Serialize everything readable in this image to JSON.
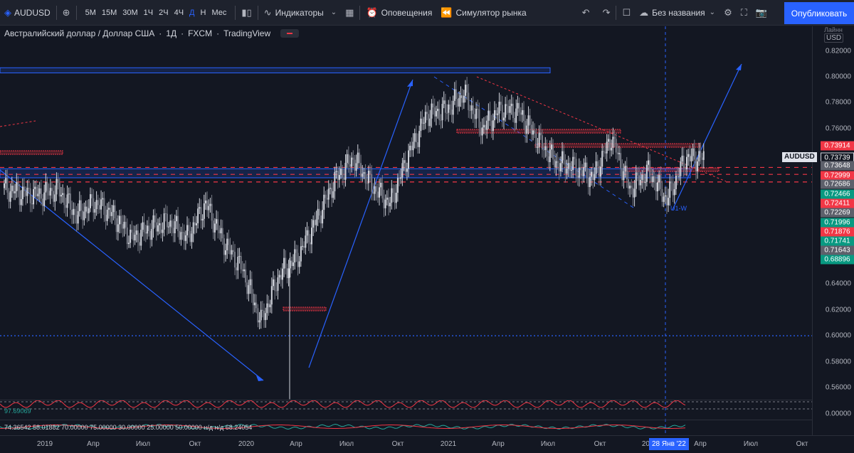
{
  "toolbar": {
    "symbol": "AUDUSD",
    "intervals": [
      "5М",
      "15М",
      "30М",
      "1Ч",
      "2Ч",
      "4Ч",
      "Д",
      "Н",
      "Мес"
    ],
    "active_interval": "Д",
    "indicators_label": "Индикаторы",
    "alerts_label": "Оповещения",
    "replay_label": "Симулятор рынка",
    "layout_name": "Без названия",
    "publish_label": "Опубликовать"
  },
  "legend": {
    "title": "Австралийский доллар / Доллар США",
    "interval": "1Д",
    "exchange": "FXCM",
    "source": "TradingView"
  },
  "price_axis": {
    "unit_label": "Лайнн",
    "currency": "USD",
    "ticks": [
      "0.82000",
      "0.80000",
      "0.78000",
      "0.76000",
      "0.64000",
      "0.62000",
      "0.60000",
      "0.58000",
      "0.56000",
      "0.00000"
    ],
    "tags": [
      {
        "value": "0.73914",
        "color": "#f23645"
      },
      {
        "value": "0.73739",
        "color": "#131722"
      },
      {
        "value": "0.73648",
        "color": "#5d606b"
      },
      {
        "value": "0.72999",
        "color": "#f23645"
      },
      {
        "value": "0.72686",
        "color": "#5d606b"
      },
      {
        "value": "0.72466",
        "color": "#089981"
      },
      {
        "value": "0.72411",
        "color": "#f23645"
      },
      {
        "value": "0.72269",
        "color": "#5d606b"
      },
      {
        "value": "0.71996",
        "color": "#089981"
      },
      {
        "value": "0.71876",
        "color": "#f23645"
      },
      {
        "value": "0.71741",
        "color": "#089981"
      },
      {
        "value": "0.71643",
        "color": "#5d606b"
      },
      {
        "value": "0.68896",
        "color": "#089981"
      }
    ],
    "symbol_label": "AUDUSD"
  },
  "time_axis": {
    "labels": [
      "2019",
      "Апр",
      "Июл",
      "Окт",
      "2020",
      "Апр",
      "Июл",
      "Окт",
      "2021",
      "Апр",
      "Июл",
      "Окт",
      "2022",
      "Апр",
      "Июл",
      "Окт"
    ],
    "cursor_date": "28 Янв '22"
  },
  "oscillators": {
    "osc1_value": "97.69069",
    "osc2_values": "74.36542 58.01882 70.00000 75.00000 30.00000 25.00000 50.00000 н/д н/д 68.24054"
  },
  "annotations": {
    "pattern_label": "U1-W"
  },
  "colors": {
    "up": "#089981",
    "down": "#f23645",
    "accent": "#2962ff",
    "zone": "#2962ff"
  },
  "chart_data": {
    "type": "candlestick",
    "title": "Австралийский доллар / Доллар США",
    "xlabel": "",
    "ylabel": "",
    "ylim": [
      0.55,
      0.83
    ],
    "x": [
      "2019-01",
      "2019-02",
      "2019-03",
      "2019-04",
      "2019-05",
      "2019-06",
      "2019-07",
      "2019-08",
      "2019-09",
      "2019-10",
      "2019-11",
      "2019-12",
      "2020-01",
      "2020-02",
      "2020-03",
      "2020-04",
      "2020-05",
      "2020-06",
      "2020-07",
      "2020-08",
      "2020-09",
      "2020-10",
      "2020-11",
      "2020-12",
      "2021-01",
      "2021-02",
      "2021-03",
      "2021-04",
      "2021-05",
      "2021-06",
      "2021-07",
      "2021-08",
      "2021-09",
      "2021-10",
      "2021-11",
      "2021-12",
      "2022-01",
      "2022-02"
    ],
    "close": [
      0.714,
      0.71,
      0.709,
      0.713,
      0.693,
      0.703,
      0.693,
      0.675,
      0.683,
      0.688,
      0.676,
      0.702,
      0.672,
      0.651,
      0.611,
      0.647,
      0.661,
      0.689,
      0.72,
      0.737,
      0.716,
      0.702,
      0.74,
      0.771,
      0.774,
      0.787,
      0.76,
      0.775,
      0.773,
      0.751,
      0.734,
      0.73,
      0.722,
      0.753,
      0.713,
      0.727,
      0.705,
      0.737
    ],
    "hlines": [
      0.72999,
      0.72466,
      0.71876,
      0.6
    ],
    "zones": [
      {
        "from": 0.803,
        "to": 0.807
      },
      {
        "from": 0.722,
        "to": 0.729
      }
    ]
  }
}
